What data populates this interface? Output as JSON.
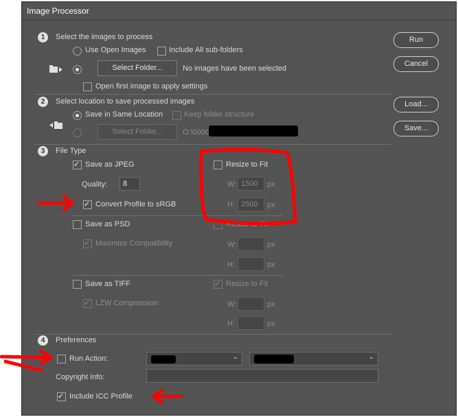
{
  "window": {
    "title": "Image Processor"
  },
  "actions": {
    "run": "Run",
    "cancel": "Cancel",
    "load": "Load...",
    "save": "Save..."
  },
  "section1": {
    "number": "1",
    "title": "Select the images to process",
    "use_open_images": "Use Open Images",
    "include_subfolders": "Include All sub-folders",
    "select_folder": "Select Folder...",
    "folder_status": "No images have been selected",
    "open_first_image": "Open first image to apply settings"
  },
  "section2": {
    "number": "2",
    "title": "Select location to save processed images",
    "save_same_location": "Save in Same Location",
    "keep_folder_structure": "Keep folder structure",
    "select_folder": "Select Folder...",
    "path_prefix": "O:\\0000"
  },
  "section3": {
    "number": "3",
    "title": "File Type",
    "jpeg": {
      "save_as": "Save as JPEG",
      "resize": "Resize to Fit",
      "quality_label": "Quality:",
      "quality_value": "8",
      "w_label": "W:",
      "w_value": "1500",
      "h_label": "H:",
      "h_value": "2500",
      "px": "px",
      "convert_profile": "Convert Profile to sRGB"
    },
    "psd": {
      "save_as": "Save as PSD",
      "resize": "Resize to Fit",
      "maximize": "Maximize Compatibility",
      "w_label": "W:",
      "h_label": "H:",
      "px": "px"
    },
    "tiff": {
      "save_as": "Save as TIFF",
      "resize": "Resize to Fit",
      "lzw": "LZW Compression",
      "w_label": "W:",
      "h_label": "H:",
      "px": "px"
    }
  },
  "section4": {
    "number": "4",
    "title": "Preferences",
    "run_action": "Run Action:",
    "copyright": "Copyright Info:",
    "include_icc": "Include ICC Profile"
  },
  "colors": {
    "dialog_bg": "#535353",
    "annotation": "#ff0000",
    "text": "#dadada"
  }
}
